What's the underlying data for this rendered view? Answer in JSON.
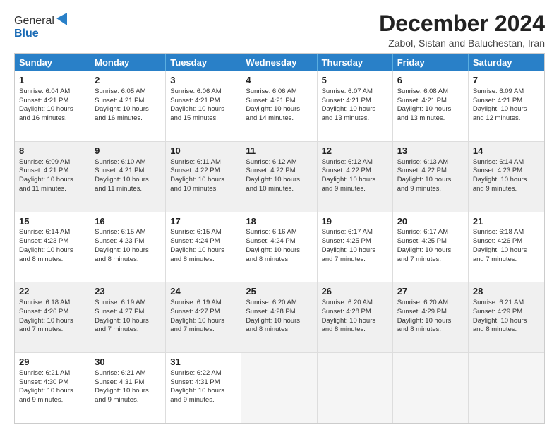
{
  "logo": {
    "general": "General",
    "blue": "Blue"
  },
  "title": "December 2024",
  "subtitle": "Zabol, Sistan and Baluchestan, Iran",
  "header_days": [
    "Sunday",
    "Monday",
    "Tuesday",
    "Wednesday",
    "Thursday",
    "Friday",
    "Saturday"
  ],
  "rows": [
    [
      {
        "day": "1",
        "lines": [
          "Sunrise: 6:04 AM",
          "Sunset: 4:21 PM",
          "Daylight: 10 hours",
          "and 16 minutes."
        ]
      },
      {
        "day": "2",
        "lines": [
          "Sunrise: 6:05 AM",
          "Sunset: 4:21 PM",
          "Daylight: 10 hours",
          "and 16 minutes."
        ]
      },
      {
        "day": "3",
        "lines": [
          "Sunrise: 6:06 AM",
          "Sunset: 4:21 PM",
          "Daylight: 10 hours",
          "and 15 minutes."
        ]
      },
      {
        "day": "4",
        "lines": [
          "Sunrise: 6:06 AM",
          "Sunset: 4:21 PM",
          "Daylight: 10 hours",
          "and 14 minutes."
        ]
      },
      {
        "day": "5",
        "lines": [
          "Sunrise: 6:07 AM",
          "Sunset: 4:21 PM",
          "Daylight: 10 hours",
          "and 13 minutes."
        ]
      },
      {
        "day": "6",
        "lines": [
          "Sunrise: 6:08 AM",
          "Sunset: 4:21 PM",
          "Daylight: 10 hours",
          "and 13 minutes."
        ]
      },
      {
        "day": "7",
        "lines": [
          "Sunrise: 6:09 AM",
          "Sunset: 4:21 PM",
          "Daylight: 10 hours",
          "and 12 minutes."
        ]
      }
    ],
    [
      {
        "day": "8",
        "lines": [
          "Sunrise: 6:09 AM",
          "Sunset: 4:21 PM",
          "Daylight: 10 hours",
          "and 11 minutes."
        ]
      },
      {
        "day": "9",
        "lines": [
          "Sunrise: 6:10 AM",
          "Sunset: 4:21 PM",
          "Daylight: 10 hours",
          "and 11 minutes."
        ]
      },
      {
        "day": "10",
        "lines": [
          "Sunrise: 6:11 AM",
          "Sunset: 4:22 PM",
          "Daylight: 10 hours",
          "and 10 minutes."
        ]
      },
      {
        "day": "11",
        "lines": [
          "Sunrise: 6:12 AM",
          "Sunset: 4:22 PM",
          "Daylight: 10 hours",
          "and 10 minutes."
        ]
      },
      {
        "day": "12",
        "lines": [
          "Sunrise: 6:12 AM",
          "Sunset: 4:22 PM",
          "Daylight: 10 hours",
          "and 9 minutes."
        ]
      },
      {
        "day": "13",
        "lines": [
          "Sunrise: 6:13 AM",
          "Sunset: 4:22 PM",
          "Daylight: 10 hours",
          "and 9 minutes."
        ]
      },
      {
        "day": "14",
        "lines": [
          "Sunrise: 6:14 AM",
          "Sunset: 4:23 PM",
          "Daylight: 10 hours",
          "and 9 minutes."
        ]
      }
    ],
    [
      {
        "day": "15",
        "lines": [
          "Sunrise: 6:14 AM",
          "Sunset: 4:23 PM",
          "Daylight: 10 hours",
          "and 8 minutes."
        ]
      },
      {
        "day": "16",
        "lines": [
          "Sunrise: 6:15 AM",
          "Sunset: 4:23 PM",
          "Daylight: 10 hours",
          "and 8 minutes."
        ]
      },
      {
        "day": "17",
        "lines": [
          "Sunrise: 6:15 AM",
          "Sunset: 4:24 PM",
          "Daylight: 10 hours",
          "and 8 minutes."
        ]
      },
      {
        "day": "18",
        "lines": [
          "Sunrise: 6:16 AM",
          "Sunset: 4:24 PM",
          "Daylight: 10 hours",
          "and 8 minutes."
        ]
      },
      {
        "day": "19",
        "lines": [
          "Sunrise: 6:17 AM",
          "Sunset: 4:25 PM",
          "Daylight: 10 hours",
          "and 7 minutes."
        ]
      },
      {
        "day": "20",
        "lines": [
          "Sunrise: 6:17 AM",
          "Sunset: 4:25 PM",
          "Daylight: 10 hours",
          "and 7 minutes."
        ]
      },
      {
        "day": "21",
        "lines": [
          "Sunrise: 6:18 AM",
          "Sunset: 4:26 PM",
          "Daylight: 10 hours",
          "and 7 minutes."
        ]
      }
    ],
    [
      {
        "day": "22",
        "lines": [
          "Sunrise: 6:18 AM",
          "Sunset: 4:26 PM",
          "Daylight: 10 hours",
          "and 7 minutes."
        ]
      },
      {
        "day": "23",
        "lines": [
          "Sunrise: 6:19 AM",
          "Sunset: 4:27 PM",
          "Daylight: 10 hours",
          "and 7 minutes."
        ]
      },
      {
        "day": "24",
        "lines": [
          "Sunrise: 6:19 AM",
          "Sunset: 4:27 PM",
          "Daylight: 10 hours",
          "and 7 minutes."
        ]
      },
      {
        "day": "25",
        "lines": [
          "Sunrise: 6:20 AM",
          "Sunset: 4:28 PM",
          "Daylight: 10 hours",
          "and 8 minutes."
        ]
      },
      {
        "day": "26",
        "lines": [
          "Sunrise: 6:20 AM",
          "Sunset: 4:28 PM",
          "Daylight: 10 hours",
          "and 8 minutes."
        ]
      },
      {
        "day": "27",
        "lines": [
          "Sunrise: 6:20 AM",
          "Sunset: 4:29 PM",
          "Daylight: 10 hours",
          "and 8 minutes."
        ]
      },
      {
        "day": "28",
        "lines": [
          "Sunrise: 6:21 AM",
          "Sunset: 4:29 PM",
          "Daylight: 10 hours",
          "and 8 minutes."
        ]
      }
    ],
    [
      {
        "day": "29",
        "lines": [
          "Sunrise: 6:21 AM",
          "Sunset: 4:30 PM",
          "Daylight: 10 hours",
          "and 9 minutes."
        ]
      },
      {
        "day": "30",
        "lines": [
          "Sunrise: 6:21 AM",
          "Sunset: 4:31 PM",
          "Daylight: 10 hours",
          "and 9 minutes."
        ]
      },
      {
        "day": "31",
        "lines": [
          "Sunrise: 6:22 AM",
          "Sunset: 4:31 PM",
          "Daylight: 10 hours",
          "and 9 minutes."
        ]
      },
      null,
      null,
      null,
      null
    ]
  ]
}
